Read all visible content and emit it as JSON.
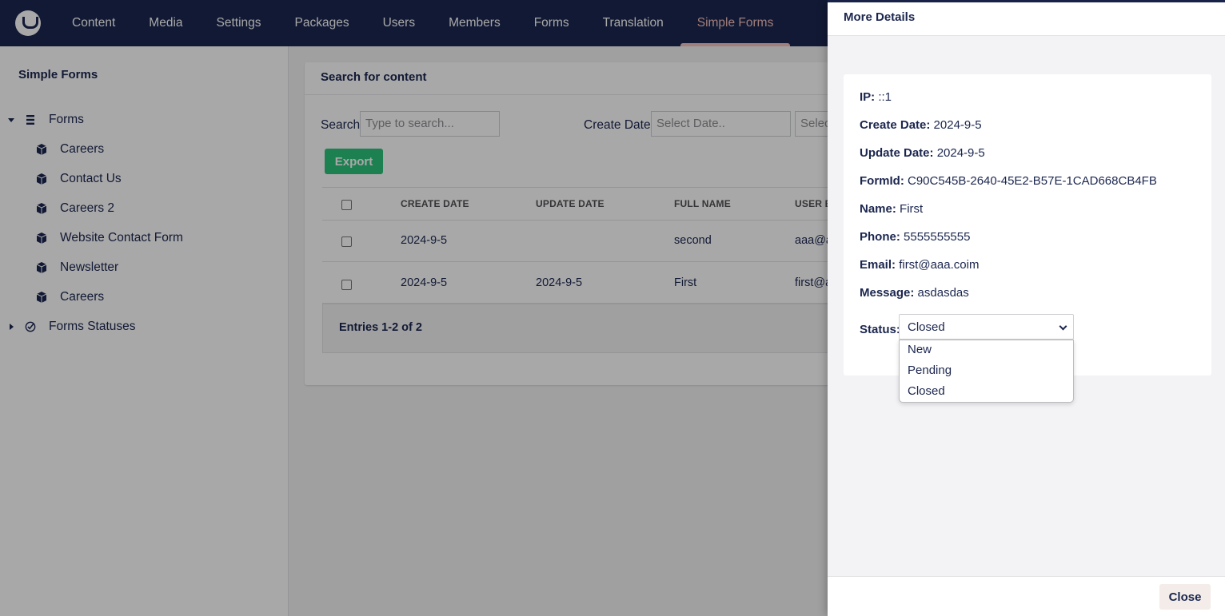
{
  "nav": {
    "items": [
      "Content",
      "Media",
      "Settings",
      "Packages",
      "Users",
      "Members",
      "Forms",
      "Translation",
      "Simple Forms"
    ],
    "active": "Simple Forms"
  },
  "tree": {
    "title": "Simple Forms",
    "root": "Forms",
    "children": [
      "Careers",
      "Contact Us",
      "Careers 2",
      "Website Contact Form",
      "Newsletter",
      "Careers"
    ],
    "statuses": "Forms Statuses"
  },
  "main": {
    "header": "Search for content",
    "search_label": "Search",
    "search_placeholder": "Type to search...",
    "create_date_label": "Create Date",
    "date_placeholder": "Select Date..",
    "date_placeholder_2": "Selec",
    "export_label": "Export",
    "columns": [
      "CREATE DATE",
      "UPDATE DATE",
      "FULL NAME",
      "USER E"
    ],
    "rows": [
      {
        "create": "2024-9-5",
        "update": "",
        "name": "second",
        "email": "aaa@aa"
      },
      {
        "create": "2024-9-5",
        "update": "2024-9-5",
        "name": "First",
        "email": "first@a"
      }
    ],
    "entries": "Entries 1-2 of 2"
  },
  "panel": {
    "title": "More Details",
    "ip_label": "IP:",
    "ip": "::1",
    "create_label": "Create Date:",
    "create": "2024-9-5",
    "update_label": "Update Date:",
    "update": "2024-9-5",
    "formid_label": "FormId:",
    "formid": "C90C545B-2640-45E2-B57E-1CAD668CB4FB",
    "name_label": "Name:",
    "name": "First",
    "phone_label": "Phone:",
    "phone": "5555555555",
    "email_label": "Email:",
    "email": "first@aaa.coim",
    "message_label": "Message:",
    "message": "asdasdas",
    "status_label": "Status:",
    "status_value": "Closed",
    "status_options": [
      "New",
      "Pending",
      "Closed"
    ],
    "close_label": "Close"
  },
  "colors": {
    "nav_bg": "#1b264f",
    "accent": "#f5c1bc",
    "export": "#2bc37c"
  }
}
